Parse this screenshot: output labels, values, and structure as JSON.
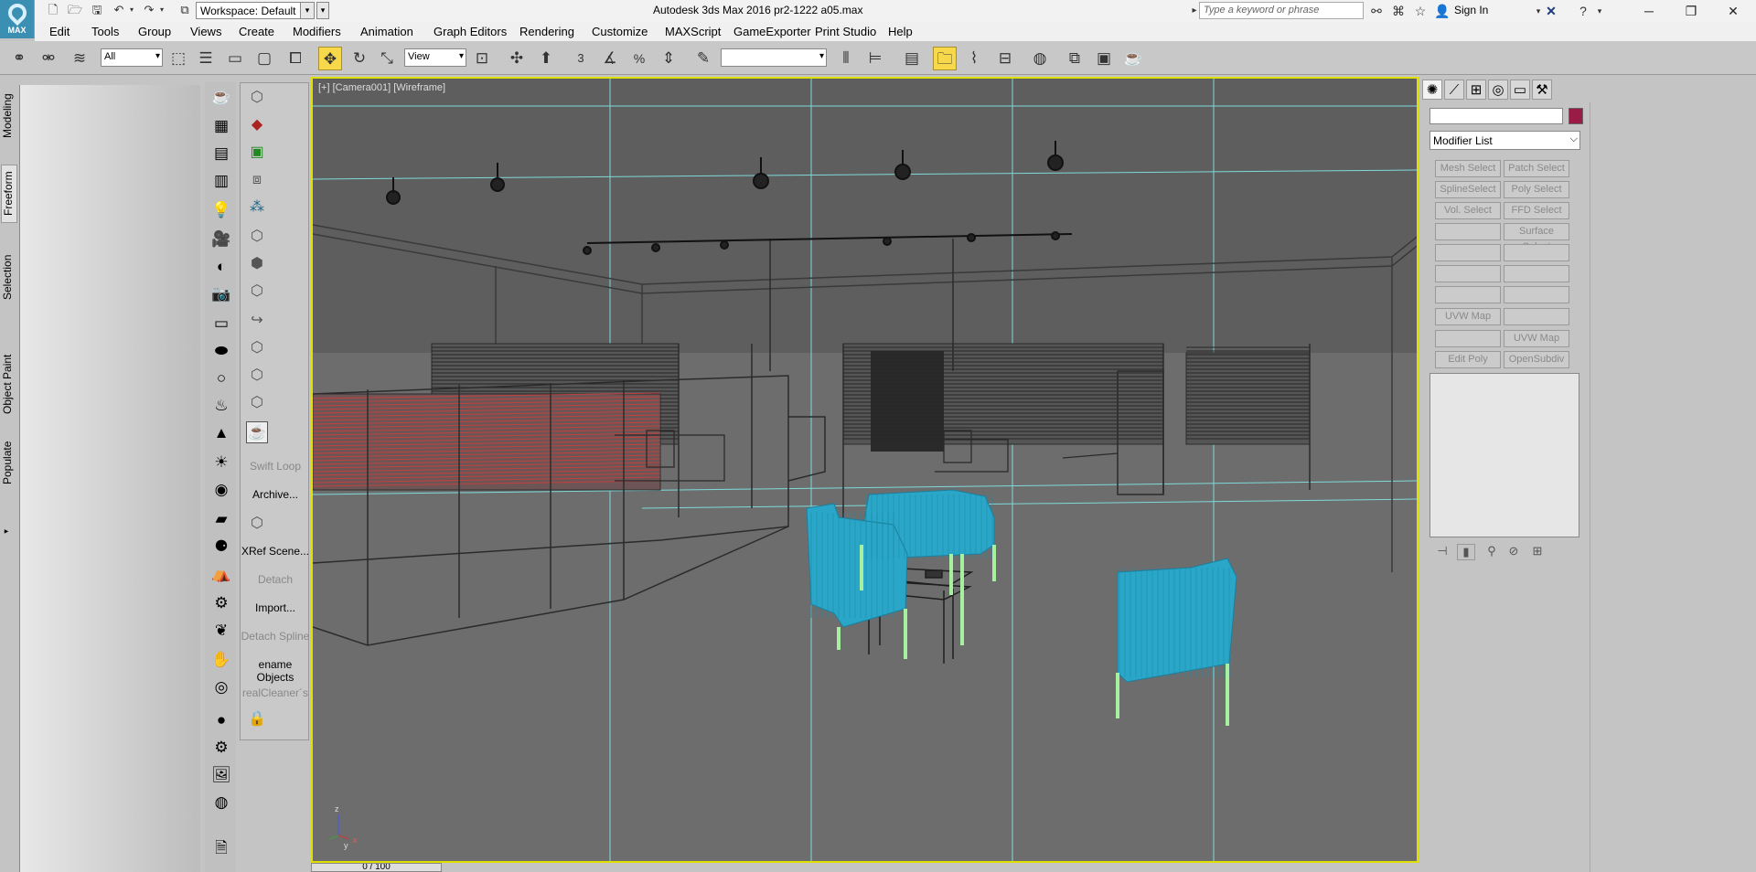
{
  "titlebar": {
    "app_title": "Autodesk 3ds Max 2016      pr2-1222 a05.max",
    "logo_label": "MAX",
    "workspace": "Workspace: Default",
    "search_placeholder": "Type a keyword or phrase",
    "signin_label": "Sign In"
  },
  "menu": [
    "Edit",
    "Tools",
    "Group",
    "Views",
    "Create",
    "Modifiers",
    "Animation",
    "Graph Editors",
    "Rendering",
    "Customize",
    "MAXScript",
    "GameExporter",
    "Print Studio",
    "Help"
  ],
  "toolbar": {
    "selection_filter": "All",
    "ref_coord": "View",
    "named_selection": "",
    "snap_label": "3"
  },
  "ribbon_tabs": [
    "Modeling",
    "Freeform",
    "Selection",
    "Object Paint",
    "Populate"
  ],
  "tool_column": {
    "swift_loop": "Swift Loop",
    "archive": "Archive...",
    "xref_scene": "XRef Scene...",
    "detach": "Detach",
    "import": "Import...",
    "detach_spline": "Detach Spline",
    "rename_objects": "ename Objects",
    "real_cleaner": "realCleaner´s"
  },
  "viewport": {
    "label": "[+] [Camera001] [Wireframe]",
    "axis_z": "z",
    "axis_y": "y",
    "axis_x": "x"
  },
  "timeline": {
    "frame": "0 / 100"
  },
  "command_panel": {
    "modifier_list": "Modifier List",
    "object_color": "#9b1b47",
    "buttons": [
      [
        "Mesh Select",
        "Patch Select"
      ],
      [
        "SplineSelect",
        "Poly Select"
      ],
      [
        "Vol. Select",
        "FFD Select"
      ],
      [
        "",
        "Surface Select"
      ],
      [
        "",
        ""
      ],
      [
        "",
        ""
      ],
      [
        "",
        ""
      ],
      [
        "UVW Map",
        ""
      ],
      [
        "",
        "UVW Map"
      ],
      [
        "Edit Poly",
        "OpenSubdiv"
      ]
    ]
  },
  "colors": {
    "viewport_bg": "#6b6b6b",
    "active_border": "#e0e000",
    "selected_object": "#2aa6c8",
    "selected_legs": "#a6f0a0",
    "grid_lines": "#7fd9d9"
  }
}
